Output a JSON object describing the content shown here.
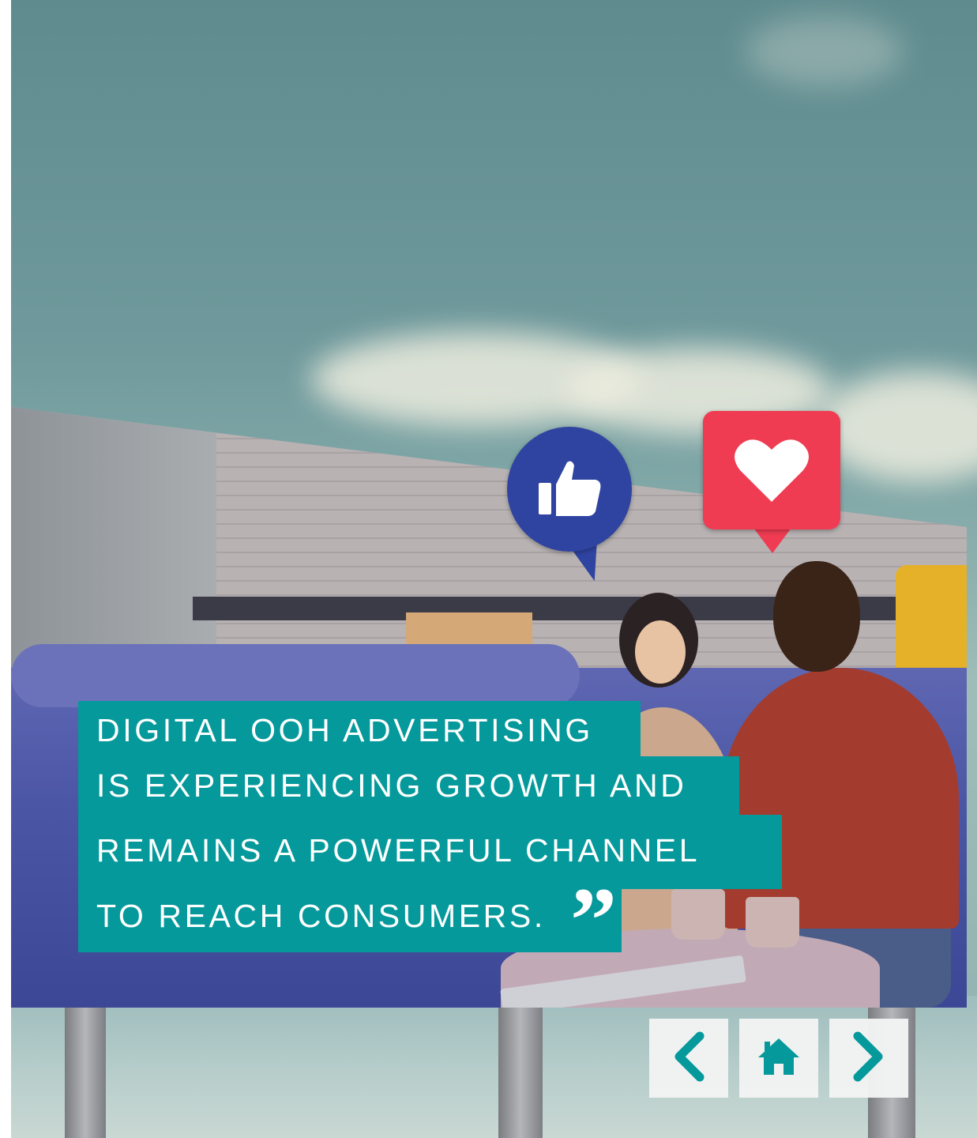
{
  "quote": {
    "lines": [
      "DIGITAL OOH ADVERTISING",
      "IS EXPERIENCING GROWTH AND",
      "REMAINS A POWERFUL CHANNEL",
      "TO REACH CONSUMERS."
    ],
    "mark": "”",
    "background_color": "#05999b",
    "text_color": "#ffffff"
  },
  "icons": {
    "like": "thumbs-up-icon",
    "heart": "heart-icon"
  },
  "navigation": {
    "previous_icon": "chevron-left-icon",
    "home_icon": "home-icon",
    "next_icon": "chevron-right-icon",
    "accent_color": "#05999b"
  }
}
